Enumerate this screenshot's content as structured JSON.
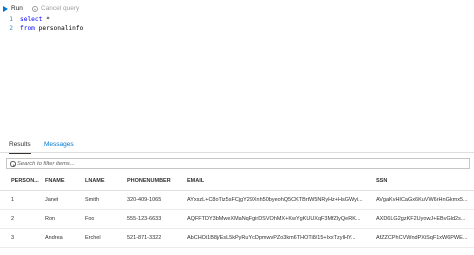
{
  "toolbar": {
    "run_label": "Run",
    "cancel_label": "Cancel query"
  },
  "editor": {
    "lines": [
      {
        "number": "1",
        "keyword": "select",
        "rest": " *"
      },
      {
        "number": "2",
        "keyword": "from",
        "rest": " personalinfo"
      }
    ]
  },
  "results": {
    "tabs": [
      {
        "label": "Results",
        "active": true
      },
      {
        "label": "Messages",
        "active": false
      }
    ],
    "search": {
      "placeholder": "Search to filter items..."
    },
    "columns": [
      "PERSON...",
      "FNAME",
      "LNAME",
      "PHONENUMBER",
      "EMAIL",
      "SSN"
    ],
    "rows": [
      [
        "1",
        "Janet",
        "Smith",
        "320-409-1065",
        "AYxszL+C8oTiz5sFCjgY29Xnh50byeohQ5CKTBrtW5NRyHz+HsGWyi...",
        "AVgaKvHICaGx6KuVW6rHnGkmx5..."
      ],
      [
        "2",
        "Ron",
        "Foo",
        "555-123-6633",
        "AQFFTDY3bMweXMaNqFgirDSVOhMX+KwYgKUUXqF3MfZlyQeRK...",
        "AXD6LG2gzKF2UyowJ+EBvGld2s..."
      ],
      [
        "3",
        "Andrea",
        "Erchel",
        "521-871-3322",
        "AbCHOi1B8j/EsL5kPyRuYcDpmwvPZo3km6THOTi8/15+IxxTzyIHY...",
        "AfZZCPhCVWndPXiSqF1xW6PWE..."
      ]
    ]
  },
  "colors": {
    "accent": "#0078d4",
    "keyword": "#0000ff",
    "line_number": "#2b91af",
    "border": "#e1dfdd"
  }
}
